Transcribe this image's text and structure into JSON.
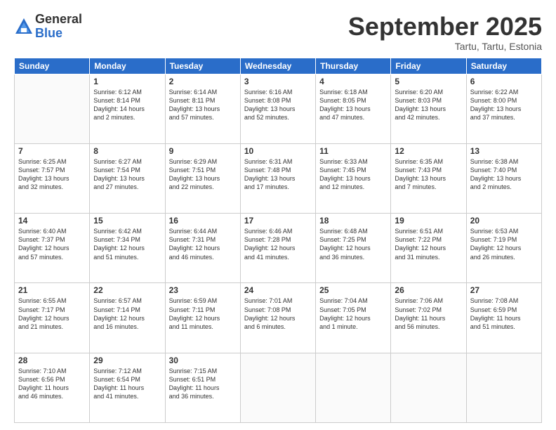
{
  "logo": {
    "general": "General",
    "blue": "Blue"
  },
  "title": "September 2025",
  "subtitle": "Tartu, Tartu, Estonia",
  "weekdays": [
    "Sunday",
    "Monday",
    "Tuesday",
    "Wednesday",
    "Thursday",
    "Friday",
    "Saturday"
  ],
  "weeks": [
    [
      {
        "day": "",
        "info": ""
      },
      {
        "day": "1",
        "info": "Sunrise: 6:12 AM\nSunset: 8:14 PM\nDaylight: 14 hours\nand 2 minutes."
      },
      {
        "day": "2",
        "info": "Sunrise: 6:14 AM\nSunset: 8:11 PM\nDaylight: 13 hours\nand 57 minutes."
      },
      {
        "day": "3",
        "info": "Sunrise: 6:16 AM\nSunset: 8:08 PM\nDaylight: 13 hours\nand 52 minutes."
      },
      {
        "day": "4",
        "info": "Sunrise: 6:18 AM\nSunset: 8:05 PM\nDaylight: 13 hours\nand 47 minutes."
      },
      {
        "day": "5",
        "info": "Sunrise: 6:20 AM\nSunset: 8:03 PM\nDaylight: 13 hours\nand 42 minutes."
      },
      {
        "day": "6",
        "info": "Sunrise: 6:22 AM\nSunset: 8:00 PM\nDaylight: 13 hours\nand 37 minutes."
      }
    ],
    [
      {
        "day": "7",
        "info": "Sunrise: 6:25 AM\nSunset: 7:57 PM\nDaylight: 13 hours\nand 32 minutes."
      },
      {
        "day": "8",
        "info": "Sunrise: 6:27 AM\nSunset: 7:54 PM\nDaylight: 13 hours\nand 27 minutes."
      },
      {
        "day": "9",
        "info": "Sunrise: 6:29 AM\nSunset: 7:51 PM\nDaylight: 13 hours\nand 22 minutes."
      },
      {
        "day": "10",
        "info": "Sunrise: 6:31 AM\nSunset: 7:48 PM\nDaylight: 13 hours\nand 17 minutes."
      },
      {
        "day": "11",
        "info": "Sunrise: 6:33 AM\nSunset: 7:45 PM\nDaylight: 13 hours\nand 12 minutes."
      },
      {
        "day": "12",
        "info": "Sunrise: 6:35 AM\nSunset: 7:43 PM\nDaylight: 13 hours\nand 7 minutes."
      },
      {
        "day": "13",
        "info": "Sunrise: 6:38 AM\nSunset: 7:40 PM\nDaylight: 13 hours\nand 2 minutes."
      }
    ],
    [
      {
        "day": "14",
        "info": "Sunrise: 6:40 AM\nSunset: 7:37 PM\nDaylight: 12 hours\nand 57 minutes."
      },
      {
        "day": "15",
        "info": "Sunrise: 6:42 AM\nSunset: 7:34 PM\nDaylight: 12 hours\nand 51 minutes."
      },
      {
        "day": "16",
        "info": "Sunrise: 6:44 AM\nSunset: 7:31 PM\nDaylight: 12 hours\nand 46 minutes."
      },
      {
        "day": "17",
        "info": "Sunrise: 6:46 AM\nSunset: 7:28 PM\nDaylight: 12 hours\nand 41 minutes."
      },
      {
        "day": "18",
        "info": "Sunrise: 6:48 AM\nSunset: 7:25 PM\nDaylight: 12 hours\nand 36 minutes."
      },
      {
        "day": "19",
        "info": "Sunrise: 6:51 AM\nSunset: 7:22 PM\nDaylight: 12 hours\nand 31 minutes."
      },
      {
        "day": "20",
        "info": "Sunrise: 6:53 AM\nSunset: 7:19 PM\nDaylight: 12 hours\nand 26 minutes."
      }
    ],
    [
      {
        "day": "21",
        "info": "Sunrise: 6:55 AM\nSunset: 7:17 PM\nDaylight: 12 hours\nand 21 minutes."
      },
      {
        "day": "22",
        "info": "Sunrise: 6:57 AM\nSunset: 7:14 PM\nDaylight: 12 hours\nand 16 minutes."
      },
      {
        "day": "23",
        "info": "Sunrise: 6:59 AM\nSunset: 7:11 PM\nDaylight: 12 hours\nand 11 minutes."
      },
      {
        "day": "24",
        "info": "Sunrise: 7:01 AM\nSunset: 7:08 PM\nDaylight: 12 hours\nand 6 minutes."
      },
      {
        "day": "25",
        "info": "Sunrise: 7:04 AM\nSunset: 7:05 PM\nDaylight: 12 hours\nand 1 minute."
      },
      {
        "day": "26",
        "info": "Sunrise: 7:06 AM\nSunset: 7:02 PM\nDaylight: 11 hours\nand 56 minutes."
      },
      {
        "day": "27",
        "info": "Sunrise: 7:08 AM\nSunset: 6:59 PM\nDaylight: 11 hours\nand 51 minutes."
      }
    ],
    [
      {
        "day": "28",
        "info": "Sunrise: 7:10 AM\nSunset: 6:56 PM\nDaylight: 11 hours\nand 46 minutes."
      },
      {
        "day": "29",
        "info": "Sunrise: 7:12 AM\nSunset: 6:54 PM\nDaylight: 11 hours\nand 41 minutes."
      },
      {
        "day": "30",
        "info": "Sunrise: 7:15 AM\nSunset: 6:51 PM\nDaylight: 11 hours\nand 36 minutes."
      },
      {
        "day": "",
        "info": ""
      },
      {
        "day": "",
        "info": ""
      },
      {
        "day": "",
        "info": ""
      },
      {
        "day": "",
        "info": ""
      }
    ]
  ]
}
